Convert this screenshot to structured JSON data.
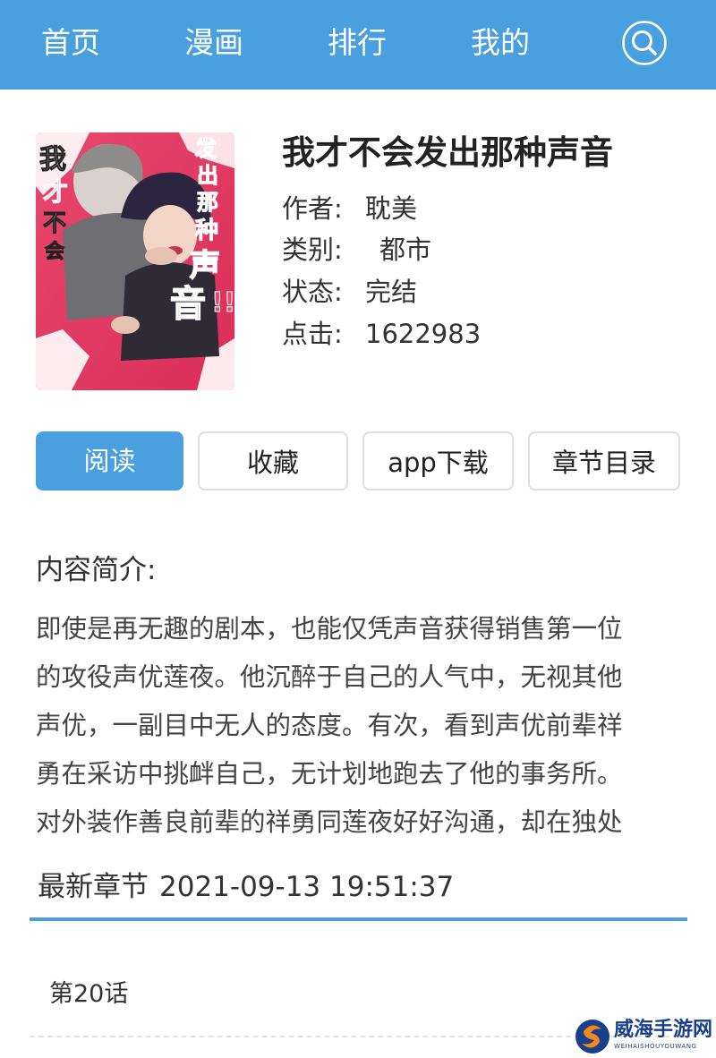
{
  "nav": {
    "items": [
      {
        "label": "首页"
      },
      {
        "label": "漫画"
      },
      {
        "label": "排行"
      },
      {
        "label": "我的"
      }
    ],
    "search_icon": "search-icon",
    "bar_color": "#4a9fdf"
  },
  "book": {
    "title": "我才不会发出那种声音",
    "cover_text": {
      "left": "我才不会…",
      "right": "发出那种声音!!"
    },
    "author_label": "作者:",
    "author": "耽美",
    "genre_label": "类别:",
    "genre": "都市",
    "status_label": "状态:",
    "status": "完结",
    "clicks_label": "点击:",
    "clicks": "1622983"
  },
  "actions": {
    "read": "阅读",
    "favorite": "收藏",
    "app_download": "app下载",
    "toc": "章节目录"
  },
  "intro": {
    "heading": "内容简介:",
    "lines": [
      "即使是再无趣的剧本，也能仅凭声音获得销售第一位",
      "的攻役声优莲夜。他沉醉于自己的人气中，无视其他",
      "声优，一副目中无人的态度。有次，看到声优前辈祥",
      "勇在采访中挑衅自己，无计划地跑去了他的事务所。",
      "对外装作善良前辈的祥勇同莲夜好好沟通，却在独处"
    ]
  },
  "latest": {
    "label": "最新章节",
    "datetime": "2021-09-13 19:51:37"
  },
  "chapters": [
    {
      "title": "第20话"
    }
  ],
  "watermark": {
    "name": "威海手游网",
    "sub": "WEIHAISHOUYOUWANG"
  },
  "colors": {
    "accent": "#4a9fdf",
    "cover_pink": "#e43a63",
    "watermark_blue": "#1a3f8a",
    "watermark_orange": "#f08a1c"
  }
}
